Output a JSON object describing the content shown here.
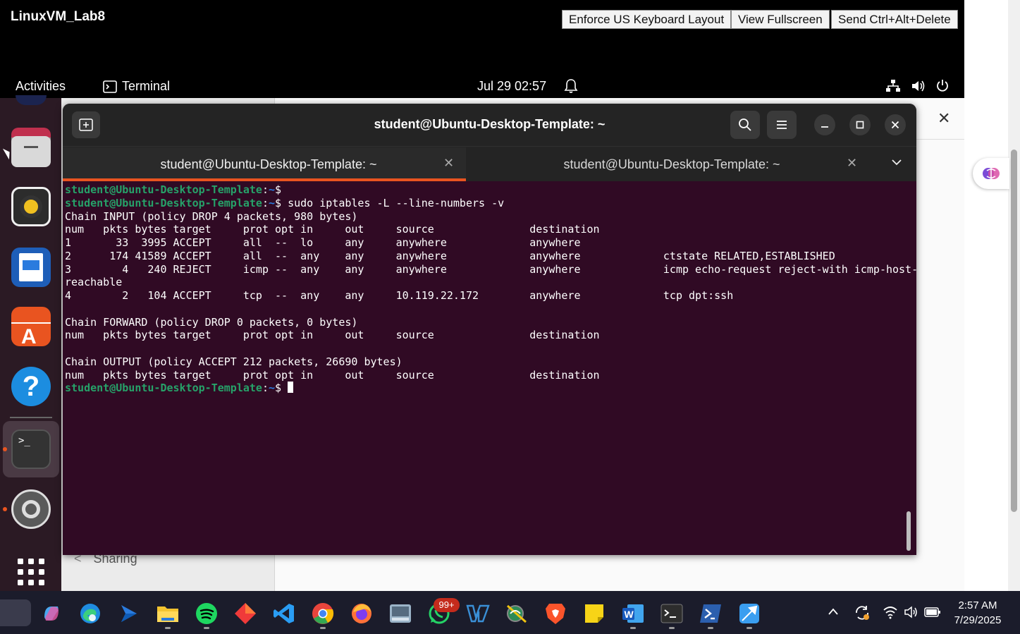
{
  "vm": {
    "title": "LinuxVM_Lab8",
    "buttons": [
      "Enforce US Keyboard Layout",
      "View Fullscreen",
      "Send Ctrl+Alt+Delete"
    ]
  },
  "ubuntu_topbar": {
    "activities": "Activities",
    "app_label": "Terminal",
    "datetime": "Jul 29  02:57"
  },
  "settings_background": {
    "sidebar_item": "Sharing"
  },
  "terminal": {
    "window_title": "student@Ubuntu-Desktop-Template: ~",
    "tabs": [
      {
        "label": "student@Ubuntu-Desktop-Template: ~",
        "active": true
      },
      {
        "label": "student@Ubuntu-Desktop-Template: ~",
        "active": false
      }
    ],
    "prompt_user": "student@Ubuntu-Desktop-Template",
    "prompt_path": "~",
    "lines": [
      {
        "type": "prompt",
        "cmd": ""
      },
      {
        "type": "prompt",
        "cmd": "sudo iptables -L --line-numbers -v"
      },
      {
        "type": "out",
        "text": "Chain INPUT (policy DROP 4 packets, 980 bytes)"
      },
      {
        "type": "out",
        "text": "num   pkts bytes target     prot opt in     out     source               destination"
      },
      {
        "type": "out",
        "text": "1       33  3995 ACCEPT     all  --  lo     any     anywhere             anywhere"
      },
      {
        "type": "out",
        "text": "2      174 41589 ACCEPT     all  --  any    any     anywhere             anywhere             ctstate RELATED,ESTABLISHED"
      },
      {
        "type": "out",
        "text": "3        4   240 REJECT     icmp --  any    any     anywhere             anywhere             icmp echo-request reject-with icmp-host-un"
      },
      {
        "type": "out",
        "text": "reachable"
      },
      {
        "type": "out",
        "text": "4        2   104 ACCEPT     tcp  --  any    any     10.119.22.172        anywhere             tcp dpt:ssh"
      },
      {
        "type": "out",
        "text": ""
      },
      {
        "type": "out",
        "text": "Chain FORWARD (policy DROP 0 packets, 0 bytes)"
      },
      {
        "type": "out",
        "text": "num   pkts bytes target     prot opt in     out     source               destination"
      },
      {
        "type": "out",
        "text": ""
      },
      {
        "type": "out",
        "text": "Chain OUTPUT (policy ACCEPT 212 packets, 26690 bytes)"
      },
      {
        "type": "out",
        "text": "num   pkts bytes target     prot opt in     out     source               destination"
      },
      {
        "type": "prompt",
        "cmd": "",
        "cursor": true
      }
    ]
  },
  "windows_taskbar": {
    "whatsapp_badge": "99+",
    "time": "2:57 AM",
    "date": "7/29/2025"
  },
  "colors": {
    "terminal_bg": "#300a24",
    "prompt_green": "#26a269",
    "path_blue": "#2a7bde",
    "tab_accent": "#e95420"
  }
}
